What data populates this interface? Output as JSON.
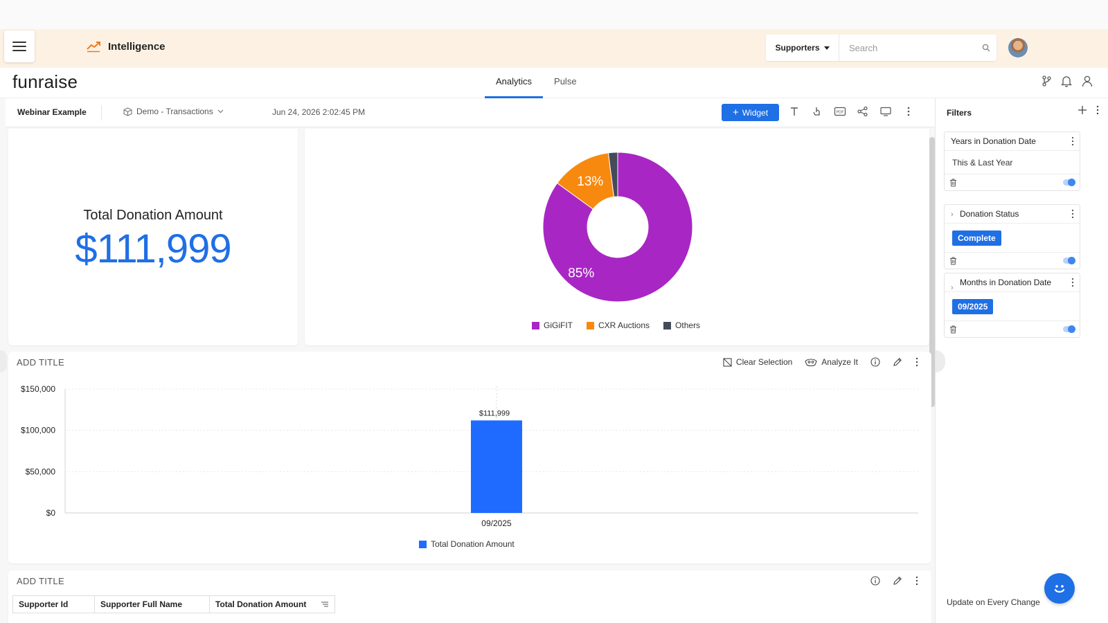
{
  "header": {
    "app_title": "Intelligence",
    "scope_dropdown": "Supporters",
    "search_placeholder": "Search"
  },
  "brand": {
    "logo_text": "funraise",
    "tabs": [
      {
        "label": "Analytics",
        "active": true
      },
      {
        "label": "Pulse",
        "active": false
      }
    ]
  },
  "dashboard": {
    "title": "Webinar Example",
    "datasource": "Demo - Transactions",
    "timestamp": "Jun 24, 2026 2:02:45 PM",
    "widget_button": "Widget"
  },
  "kpi": {
    "label": "Total Donation Amount",
    "value": "$111,999"
  },
  "colors": {
    "accent": "#1f6fe5",
    "gigifit": "#a827c4",
    "cxr": "#f7890f",
    "others": "#444b5a",
    "bar": "#1f6bff"
  },
  "pie_chart": {
    "chart_data": {
      "type": "pie",
      "donut": true,
      "categories": [
        "GiGiFIT",
        "CXR Auctions",
        "Others"
      ],
      "values": [
        85,
        13,
        2
      ],
      "labels": [
        "85%",
        "13%",
        ""
      ],
      "legend_position": "bottom"
    }
  },
  "bar_widget": {
    "title": "ADD TITLE",
    "clear_selection": "Clear Selection",
    "analyze_it": "Analyze It",
    "chart_data": {
      "type": "bar",
      "categories": [
        "09/2025"
      ],
      "series": [
        {
          "name": "Total Donation Amount",
          "values": [
            111999
          ]
        }
      ],
      "data_labels": [
        "$111,999"
      ],
      "ylim": [
        0,
        150000
      ],
      "yticks": [
        0,
        50000,
        100000,
        150000
      ],
      "ytick_labels": [
        "$0",
        "$50,000",
        "$100,000",
        "$150,000"
      ],
      "grid": true,
      "legend_position": "bottom"
    }
  },
  "table_widget": {
    "title": "ADD TITLE",
    "columns": [
      "Supporter Id",
      "Supporter Full Name",
      "Total Donation Amount"
    ]
  },
  "filters": {
    "title": "Filters",
    "items": [
      {
        "title": "Years in Donation Date",
        "value": "This & Last Year",
        "chip": false,
        "expandable": false
      },
      {
        "title": "Donation Status",
        "value": "Complete",
        "chip": true,
        "expandable": true
      },
      {
        "title": "Months in Donation Date",
        "value": "09/2025",
        "chip": true,
        "expandable": true
      }
    ],
    "update_label": "Update on Every Change"
  }
}
